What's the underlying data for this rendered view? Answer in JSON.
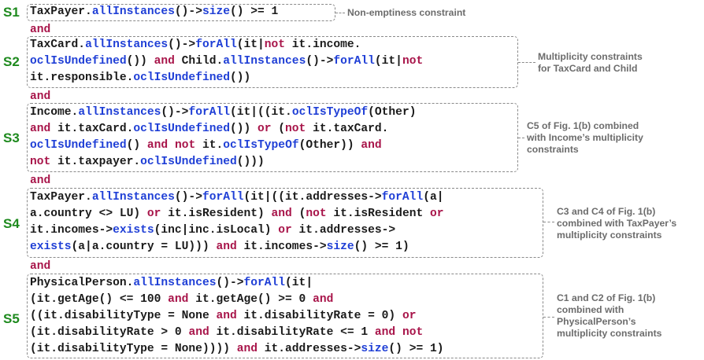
{
  "s1": {
    "label": "S1",
    "lines": [
      [
        [
          "t",
          "TaxPayer."
        ],
        [
          "f",
          "allInstances"
        ],
        [
          "t",
          "()->"
        ],
        [
          "f",
          "size"
        ],
        [
          "t",
          "() >= 1"
        ]
      ]
    ],
    "note": [
      "Non-emptiness constraint"
    ]
  },
  "and1": "and",
  "s2": {
    "label": "S2",
    "lines": [
      [
        [
          "t",
          "TaxCard."
        ],
        [
          "f",
          "allInstances"
        ],
        [
          "t",
          "()->"
        ],
        [
          "f",
          "forAll"
        ],
        [
          "t",
          "(it|"
        ],
        [
          "k",
          "not"
        ],
        [
          "t",
          " it.income."
        ]
      ],
      [
        [
          "f",
          "oclIsUndefined"
        ],
        [
          "t",
          "()) "
        ],
        [
          "k",
          "and"
        ],
        [
          "t",
          " Child."
        ],
        [
          "f",
          "allInstances"
        ],
        [
          "t",
          "()->"
        ],
        [
          "f",
          "forAll"
        ],
        [
          "t",
          "(it|"
        ],
        [
          "k",
          "not"
        ]
      ],
      [
        [
          "t",
          "it.responsible."
        ],
        [
          "f",
          "oclIsUndefined"
        ],
        [
          "t",
          "())"
        ]
      ]
    ],
    "note": [
      "Multiplicity constraints",
      "for TaxCard and Child"
    ]
  },
  "and2": "and",
  "s3": {
    "label": "S3",
    "lines": [
      [
        [
          "t",
          "Income."
        ],
        [
          "f",
          "allInstances"
        ],
        [
          "t",
          "()->"
        ],
        [
          "f",
          "forAll"
        ],
        [
          "t",
          "(it|((it."
        ],
        [
          "f",
          "oclIsTypeOf"
        ],
        [
          "t",
          "(Other)"
        ]
      ],
      [
        [
          "k",
          "and"
        ],
        [
          "t",
          " it.taxCard."
        ],
        [
          "f",
          "oclIsUndefined"
        ],
        [
          "t",
          "()) "
        ],
        [
          "k",
          "or"
        ],
        [
          "t",
          " ("
        ],
        [
          "k",
          "not"
        ],
        [
          "t",
          " it.taxCard."
        ]
      ],
      [
        [
          "f",
          "oclIsUndefined"
        ],
        [
          "t",
          "() "
        ],
        [
          "k",
          "and"
        ],
        [
          "t",
          " "
        ],
        [
          "k",
          "not"
        ],
        [
          "t",
          " it."
        ],
        [
          "f",
          "oclIsTypeOf"
        ],
        [
          "t",
          "(Other)) "
        ],
        [
          "k",
          "and"
        ]
      ],
      [
        [
          "k",
          "not"
        ],
        [
          "t",
          " it.taxpayer."
        ],
        [
          "f",
          "oclIsUndefined"
        ],
        [
          "t",
          "()))"
        ]
      ]
    ],
    "note": [
      "C5 of Fig. 1(b) combined",
      "with Income’s multiplicity",
      "constraints"
    ]
  },
  "and3": "and",
  "s4": {
    "label": "S4",
    "lines": [
      [
        [
          "t",
          "TaxPayer."
        ],
        [
          "f",
          "allInstances"
        ],
        [
          "t",
          "()->"
        ],
        [
          "f",
          "forAll"
        ],
        [
          "t",
          "(it|((it.addresses->"
        ],
        [
          "f",
          "forAll"
        ],
        [
          "t",
          "(a|"
        ]
      ],
      [
        [
          "t",
          "a.country <> LU) "
        ],
        [
          "k",
          "or"
        ],
        [
          "t",
          " it.isResident) "
        ],
        [
          "k",
          "and"
        ],
        [
          "t",
          " ("
        ],
        [
          "k",
          "not"
        ],
        [
          "t",
          " it.isResident "
        ],
        [
          "k",
          "or"
        ]
      ],
      [
        [
          "t",
          "it.incomes->"
        ],
        [
          "f",
          "exists"
        ],
        [
          "t",
          "(inc|inc.isLocal) "
        ],
        [
          "k",
          "or"
        ],
        [
          "t",
          " it.addresses->"
        ]
      ],
      [
        [
          "f",
          "exists"
        ],
        [
          "t",
          "(a|a.country = LU))) "
        ],
        [
          "k",
          "and"
        ],
        [
          "t",
          " it.incomes->"
        ],
        [
          "f",
          "size"
        ],
        [
          "t",
          "() >= 1)"
        ]
      ]
    ],
    "note": [
      "C3 and C4 of Fig. 1(b)",
      "combined with TaxPayer’s",
      "multiplicity constraints"
    ]
  },
  "and4": "and",
  "s5": {
    "label": "S5",
    "lines": [
      [
        [
          "t",
          "PhysicalPerson."
        ],
        [
          "f",
          "allInstances"
        ],
        [
          "t",
          "()->"
        ],
        [
          "f",
          "forAll"
        ],
        [
          "t",
          "(it|"
        ]
      ],
      [
        [
          "t",
          "(it.getAge() <= 100 "
        ],
        [
          "k",
          "and"
        ],
        [
          "t",
          " it.getAge() >= 0 "
        ],
        [
          "k",
          "and"
        ]
      ],
      [
        [
          "t",
          "((it.disabilityType = None "
        ],
        [
          "k",
          "and"
        ],
        [
          "t",
          " it.disabilityRate = 0) "
        ],
        [
          "k",
          "or"
        ]
      ],
      [
        [
          "t",
          "(it.disabilityRate > 0 "
        ],
        [
          "k",
          "and"
        ],
        [
          "t",
          " it.disabilityRate <= 1 "
        ],
        [
          "k",
          "and"
        ],
        [
          "t",
          " "
        ],
        [
          "k",
          "not"
        ]
      ],
      [
        [
          "t",
          "(it.disabilityType = None)))) "
        ],
        [
          "k",
          "and"
        ],
        [
          "t",
          " it.addresses->"
        ],
        [
          "f",
          "size"
        ],
        [
          "t",
          "() >= 1)"
        ]
      ]
    ],
    "note": [
      "C1 and C2 of Fig. 1(b)",
      "combined with",
      "PhysicalPerson’s",
      "multiplicity constraints"
    ]
  }
}
